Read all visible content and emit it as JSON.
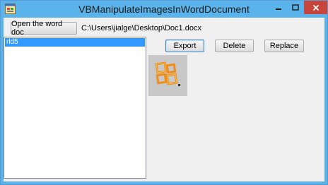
{
  "window": {
    "title": "VBManipulateImagesInWordDocument"
  },
  "toolbar": {
    "open_button_label": "Open the word doc",
    "file_path": "C:\\Users\\jialge\\Desktop\\Doc1.docx"
  },
  "list": {
    "items": [
      {
        "label": "rld5",
        "selected": true
      }
    ]
  },
  "actions": {
    "export_label": "Export",
    "delete_label": "Delete",
    "replace_label": "Replace"
  },
  "colors": {
    "titlebar": "#5ab3eb",
    "close_button": "#c7453a",
    "selection": "#3399ff",
    "office_logo": "#f08c1a"
  },
  "icons": {
    "app": "form-icon",
    "picture": "office-logo-icon"
  }
}
